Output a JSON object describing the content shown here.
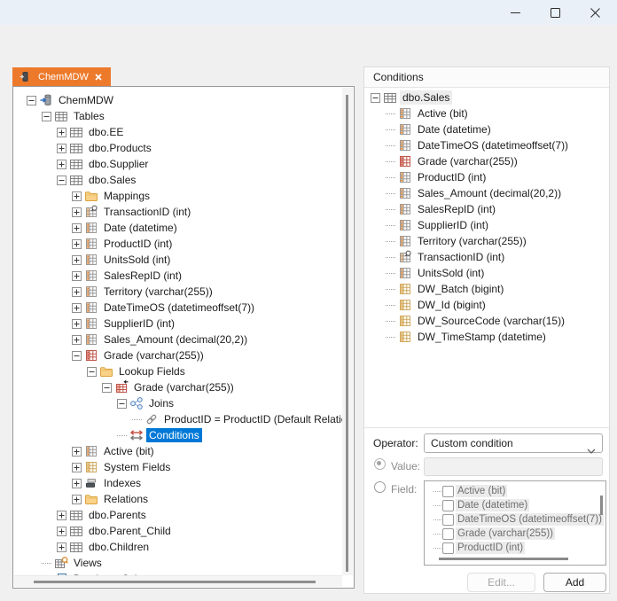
{
  "titlebar": {
    "buttons": [
      "minimize",
      "maximize",
      "close"
    ]
  },
  "tab": {
    "label": "ChemMDW",
    "icon": "database-icon",
    "close_icon": "close-icon"
  },
  "colors": {
    "accent_orange": "#ED7A2B",
    "selection_blue": "#0078D7"
  },
  "left_tree": {
    "items": [
      {
        "label": "ChemMDW",
        "icon": "database-icon",
        "level": 0,
        "expander": "minus"
      },
      {
        "label": "Tables",
        "icon": "tables-icon",
        "level": 1,
        "expander": "minus"
      },
      {
        "label": "dbo.EE",
        "icon": "table-icon",
        "level": 2,
        "expander": "plus"
      },
      {
        "label": "dbo.Products",
        "icon": "table-icon",
        "level": 2,
        "expander": "plus"
      },
      {
        "label": "dbo.Supplier",
        "icon": "table-icon",
        "level": 2,
        "expander": "plus"
      },
      {
        "label": "dbo.Sales",
        "icon": "table-icon",
        "level": 2,
        "expander": "minus"
      },
      {
        "label": "Mappings",
        "icon": "folder-icon",
        "level": 3,
        "expander": "plus"
      },
      {
        "label": "TransactionID (int)",
        "icon": "column-key-icon",
        "level": 3,
        "expander": "plus"
      },
      {
        "label": "Date (datetime)",
        "icon": "column-icon",
        "level": 3,
        "expander": "plus"
      },
      {
        "label": "ProductID (int)",
        "icon": "column-icon",
        "level": 3,
        "expander": "plus"
      },
      {
        "label": "UnitsSold (int)",
        "icon": "column-icon",
        "level": 3,
        "expander": "plus"
      },
      {
        "label": "SalesRepID (int)",
        "icon": "column-icon",
        "level": 3,
        "expander": "plus"
      },
      {
        "label": "Territory (varchar(255))",
        "icon": "column-icon",
        "level": 3,
        "expander": "plus"
      },
      {
        "label": "DateTimeOS (datetimeoffset(7))",
        "icon": "column-icon",
        "level": 3,
        "expander": "plus"
      },
      {
        "label": "SupplierID (int)",
        "icon": "column-icon",
        "level": 3,
        "expander": "plus"
      },
      {
        "label": "Sales_Amount (decimal(20,2))",
        "icon": "column-icon",
        "level": 3,
        "expander": "plus"
      },
      {
        "label": "Grade (varchar(255))",
        "icon": "column-red-icon",
        "level": 3,
        "expander": "minus"
      },
      {
        "label": "Lookup Fields",
        "icon": "folder-icon",
        "level": 4,
        "expander": "minus"
      },
      {
        "label": "Grade (varchar(255))",
        "icon": "lookup-column-icon",
        "level": 5,
        "expander": "minus"
      },
      {
        "label": "Joins",
        "icon": "joins-icon",
        "level": 6,
        "expander": "minus"
      },
      {
        "label": "ProductID = ProductID (Default Relation)",
        "icon": "link-icon",
        "level": 7,
        "expander": null
      },
      {
        "label": "Conditions",
        "icon": "conditions-icon",
        "level": 6,
        "expander": null,
        "selected": "blue"
      },
      {
        "label": "Active (bit)",
        "icon": "column-icon",
        "level": 3,
        "expander": "plus"
      },
      {
        "label": "System Fields",
        "icon": "column-yellow-icon",
        "level": 3,
        "expander": "plus"
      },
      {
        "label": "Indexes",
        "icon": "indexes-icon",
        "level": 3,
        "expander": "plus"
      },
      {
        "label": "Relations",
        "icon": "folder-icon",
        "level": 3,
        "expander": "plus"
      },
      {
        "label": "dbo.Parents",
        "icon": "table-icon",
        "level": 2,
        "expander": "plus"
      },
      {
        "label": "dbo.Parent_Child",
        "icon": "table-icon",
        "level": 2,
        "expander": "plus"
      },
      {
        "label": "dbo.Children",
        "icon": "table-icon",
        "level": 2,
        "expander": "plus"
      },
      {
        "label": "Views",
        "icon": "views-icon",
        "level": 1,
        "expander": null
      },
      {
        "label": "Database Schemas",
        "icon": "schemas-icon",
        "level": 1,
        "expander": null
      }
    ]
  },
  "right_panel": {
    "title": "Conditions",
    "tree": {
      "items": [
        {
          "label": "dbo.Sales",
          "icon": "table-icon",
          "level": 0,
          "expander": "minus",
          "selected": "gray"
        },
        {
          "label": "Active (bit)",
          "icon": "column-icon",
          "level": 1,
          "expander": null
        },
        {
          "label": "Date (datetime)",
          "icon": "column-icon",
          "level": 1,
          "expander": null
        },
        {
          "label": "DateTimeOS (datetimeoffset(7))",
          "icon": "column-icon",
          "level": 1,
          "expander": null
        },
        {
          "label": "Grade (varchar(255))",
          "icon": "column-red-icon",
          "level": 1,
          "expander": null
        },
        {
          "label": "ProductID (int)",
          "icon": "column-icon",
          "level": 1,
          "expander": null
        },
        {
          "label": "Sales_Amount (decimal(20,2))",
          "icon": "column-icon",
          "level": 1,
          "expander": null
        },
        {
          "label": "SalesRepID (int)",
          "icon": "column-icon",
          "level": 1,
          "expander": null
        },
        {
          "label": "SupplierID (int)",
          "icon": "column-icon",
          "level": 1,
          "expander": null
        },
        {
          "label": "Territory (varchar(255))",
          "icon": "column-icon",
          "level": 1,
          "expander": null
        },
        {
          "label": "TransactionID (int)",
          "icon": "column-key-icon",
          "level": 1,
          "expander": null
        },
        {
          "label": "UnitsSold (int)",
          "icon": "column-icon",
          "level": 1,
          "expander": null
        },
        {
          "label": "DW_Batch (bigint)",
          "icon": "column-yellow-icon",
          "level": 1,
          "expander": null
        },
        {
          "label": "DW_Id (bigint)",
          "icon": "column-yellow-icon",
          "level": 1,
          "expander": null
        },
        {
          "label": "DW_SourceCode (varchar(15))",
          "icon": "column-yellow-icon",
          "level": 1,
          "expander": null
        },
        {
          "label": "DW_TimeStamp (datetime)",
          "icon": "column-yellow-icon",
          "level": 1,
          "expander": null
        }
      ]
    },
    "operator": {
      "label": "Operator:",
      "value": "Custom condition",
      "icon": "chevron-down-icon"
    },
    "value_row": {
      "label": "Value:",
      "input_value": "",
      "radio_checked": true
    },
    "field_row": {
      "label": "Field:",
      "radio_checked": false,
      "options": [
        {
          "label": "Active (bit)",
          "checked": false
        },
        {
          "label": "Date (datetime)",
          "checked": false
        },
        {
          "label": "DateTimeOS (datetimeoffset(7))",
          "checked": false
        },
        {
          "label": "Grade (varchar(255))",
          "checked": false
        },
        {
          "label": "ProductID (int)",
          "checked": false
        }
      ]
    },
    "buttons": {
      "edit": "Edit...",
      "add": "Add"
    }
  }
}
